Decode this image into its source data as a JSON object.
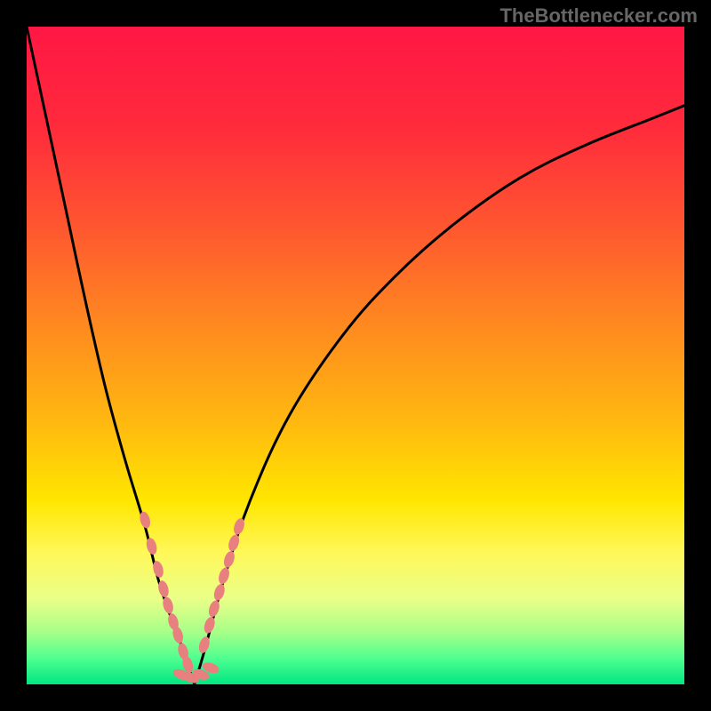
{
  "watermark": "TheBottlenecker.com",
  "chart_data": {
    "type": "line",
    "title": "",
    "xlabel": "",
    "ylabel": "",
    "xlim": [
      0,
      100
    ],
    "ylim": [
      0,
      100
    ],
    "gradient_stops": [
      {
        "offset": 0,
        "color": "#ff1744"
      },
      {
        "offset": 15,
        "color": "#ff2a3c"
      },
      {
        "offset": 30,
        "color": "#ff5530"
      },
      {
        "offset": 45,
        "color": "#ff8820"
      },
      {
        "offset": 60,
        "color": "#ffb810"
      },
      {
        "offset": 72,
        "color": "#ffe600"
      },
      {
        "offset": 80,
        "color": "#fff85a"
      },
      {
        "offset": 87,
        "color": "#eaff88"
      },
      {
        "offset": 92,
        "color": "#a8ff88"
      },
      {
        "offset": 96,
        "color": "#50ff90"
      },
      {
        "offset": 100,
        "color": "#00e682"
      }
    ],
    "series": [
      {
        "name": "left-curve",
        "type": "curve",
        "x": [
          0,
          3,
          6,
          9,
          12,
          15,
          18,
          20,
          22,
          23.5,
          24.5,
          25.5
        ],
        "y": [
          100,
          86,
          72,
          58,
          45,
          34,
          24,
          16,
          10,
          6,
          3,
          0
        ]
      },
      {
        "name": "right-curve",
        "type": "curve",
        "x": [
          25.5,
          27,
          30,
          34,
          40,
          48,
          56,
          65,
          75,
          85,
          95,
          100
        ],
        "y": [
          0,
          5,
          16,
          28,
          41,
          53,
          62,
          70,
          77,
          82,
          86,
          88
        ]
      }
    ],
    "markers": {
      "color": "#e88080",
      "radius_long": 6,
      "radius_short": 3,
      "left_branch": [
        {
          "x": 18,
          "y": 25
        },
        {
          "x": 19,
          "y": 21
        },
        {
          "x": 20,
          "y": 17.5
        },
        {
          "x": 20.8,
          "y": 14.5
        },
        {
          "x": 21.5,
          "y": 12
        },
        {
          "x": 22.3,
          "y": 9.5
        },
        {
          "x": 23,
          "y": 7.5
        },
        {
          "x": 23.8,
          "y": 5
        },
        {
          "x": 24.5,
          "y": 3
        }
      ],
      "right_branch": [
        {
          "x": 27,
          "y": 6
        },
        {
          "x": 27.8,
          "y": 9
        },
        {
          "x": 28.5,
          "y": 11.5
        },
        {
          "x": 29.3,
          "y": 14
        },
        {
          "x": 30,
          "y": 16.5
        },
        {
          "x": 30.8,
          "y": 19
        },
        {
          "x": 31.5,
          "y": 21.5
        },
        {
          "x": 32.3,
          "y": 24
        }
      ],
      "bottom": [
        {
          "x": 23.5,
          "y": 1.5
        },
        {
          "x": 25,
          "y": 1
        },
        {
          "x": 26.5,
          "y": 1.5
        },
        {
          "x": 28,
          "y": 2.5
        }
      ]
    }
  }
}
